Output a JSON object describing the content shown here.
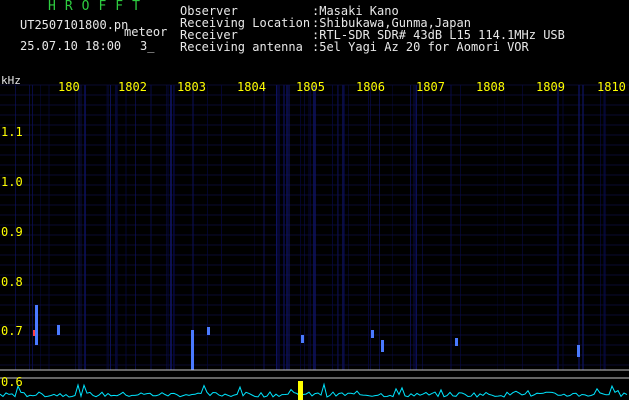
{
  "header": {
    "brand": "HROFFT",
    "filename": "UT2507101800.pn",
    "meteor_word": "meteor",
    "datetime": "25.07.10 18:00",
    "count": "3_",
    "info": [
      {
        "label": "Observer",
        "value": ":Masaki Kano"
      },
      {
        "label": "Receiving Location",
        "value": ":Shibukawa,Gunma,Japan"
      },
      {
        "label": "Receiver",
        "value": ":RTL-SDR SDR# 43dB L15 114.1MHz USB"
      },
      {
        "label": "Receiving antenna",
        "value": ":5el Yagi Az 20 for Aomori VOR"
      }
    ]
  },
  "axes": {
    "y_unit": "kHz",
    "x_ticks": [
      "180",
      "180",
      "180",
      "180",
      "180",
      "180",
      "180",
      "180",
      "180",
      "1810"
    ],
    "x_tick_suffixes": [
      "",
      "2",
      "3",
      "4",
      "5",
      "6",
      "7",
      "8",
      "9",
      ""
    ],
    "y_ticks": [
      "1.1",
      "1.0",
      "0.9",
      "0.8",
      "0.7",
      "0.6"
    ]
  },
  "colors": {
    "brand": "#2ecc40",
    "text": "#e8e8e8",
    "ticks": "#ffff00",
    "spectrum_trace": "#00e5ff"
  }
}
